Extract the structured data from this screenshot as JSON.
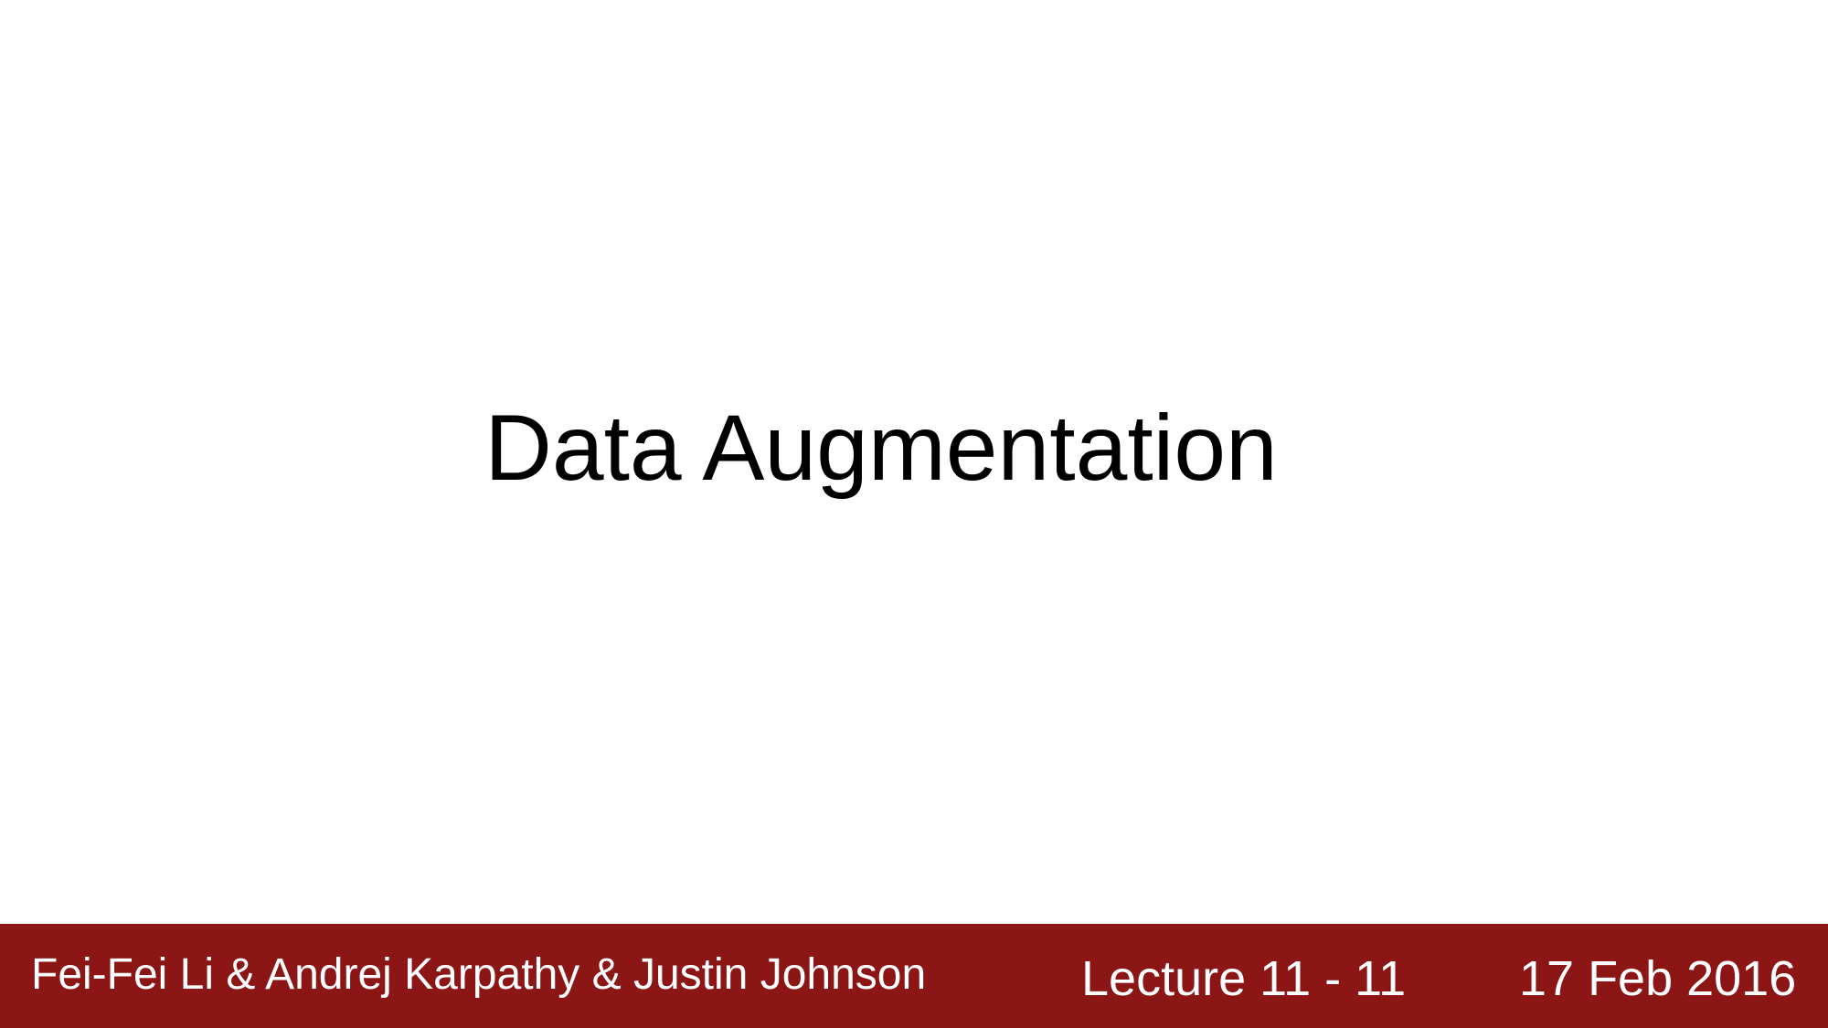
{
  "slide": {
    "title": "Data Augmentation"
  },
  "footer": {
    "authors": "Fei-Fei Li & Andrej Karpathy & Justin Johnson",
    "lecture": "Lecture 11 - 11",
    "date": "17 Feb 2016",
    "background_color": "#8c1515",
    "text_color": "#ffffff"
  }
}
